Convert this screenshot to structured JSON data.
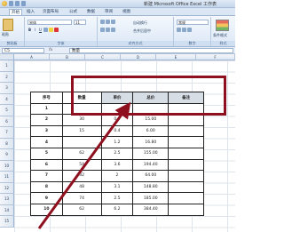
{
  "window": {
    "title": "新建 Microsoft Office Excel 工作表"
  },
  "menu": {
    "tabs": [
      "开始",
      "插入",
      "页面布局",
      "公式",
      "数据",
      "审阅",
      "视图"
    ]
  },
  "ribbon": {
    "paste_label": "粘贴",
    "clipboard_label": "剪贴板",
    "font_name": "宋体",
    "font_size": "11",
    "bold": "B",
    "italic": "I",
    "underline": "U",
    "font_group_label": "字体",
    "wrap_text": "自动换行",
    "merge_center": "合并后居中",
    "align_group_label": "对齐方式",
    "number_format": "常规",
    "number_group_label": "数字",
    "cond_format": "条件格式",
    "styles_group_label": "样式"
  },
  "formula_bar": {
    "name_box": "C5",
    "fx": "fx",
    "value": "数量"
  },
  "columns": [
    "A",
    "B",
    "C",
    "D",
    "E",
    "F"
  ],
  "rows": [
    "1",
    "2",
    "3",
    "4",
    "5",
    "6",
    "7",
    "8",
    "9",
    "10",
    "11",
    "12",
    "13",
    "14",
    "15"
  ],
  "table": {
    "headers": [
      "序号",
      "数量",
      "单价",
      "总价",
      "备注"
    ],
    "rows": [
      [
        "1",
        "",
        "",
        "",
        ""
      ],
      [
        "2",
        "30",
        "0.5",
        "15.00",
        ""
      ],
      [
        "3",
        "15",
        "0.4",
        "6.00",
        ""
      ],
      [
        "4",
        "",
        "1.2",
        "16.80",
        ""
      ],
      [
        "5",
        "62",
        "2.5",
        "155.00",
        ""
      ],
      [
        "6",
        "54",
        "3.6",
        "194.40",
        ""
      ],
      [
        "7",
        "32",
        "2",
        "64.00",
        ""
      ],
      [
        "8",
        "48",
        "3.1",
        "148.80",
        ""
      ],
      [
        "9",
        "74",
        "2.5",
        "185.00",
        ""
      ],
      [
        "10",
        "62",
        "6.2",
        "384.40",
        ""
      ]
    ]
  },
  "colors": {
    "highlight": "#8e0f1e",
    "header_shade": "#d7dde5"
  }
}
